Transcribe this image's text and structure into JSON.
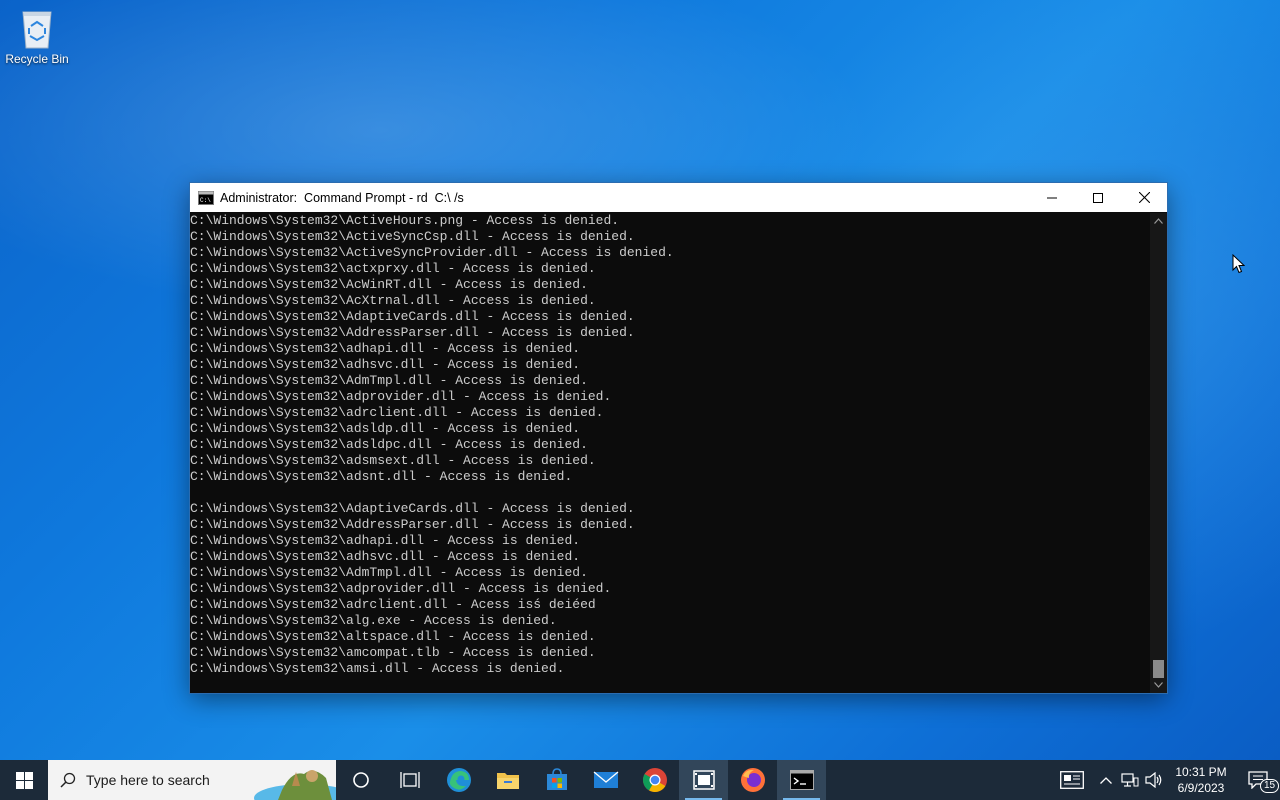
{
  "desktop": {
    "icons": [
      {
        "label": "Recycle Bin",
        "icon": "recycle-bin-icon"
      }
    ]
  },
  "console": {
    "title": "Administrator:  Command Prompt - rd  C:\\ /s",
    "lines": [
      "C:\\Windows\\System32\\ActiveHours.png - Access is denied.",
      "C:\\Windows\\System32\\ActiveSyncCsp.dll - Access is denied.",
      "C:\\Windows\\System32\\ActiveSyncProvider.dll - Access is denied.",
      "C:\\Windows\\System32\\actxprxy.dll - Access is denied.",
      "C:\\Windows\\System32\\AcWinRT.dll - Access is denied.",
      "C:\\Windows\\System32\\AcXtrnal.dll - Access is denied.",
      "C:\\Windows\\System32\\AdaptiveCards.dll - Access is denied.",
      "C:\\Windows\\System32\\AddressParser.dll - Access is denied.",
      "C:\\Windows\\System32\\adhapi.dll - Access is denied.",
      "C:\\Windows\\System32\\adhsvc.dll - Access is denied.",
      "C:\\Windows\\System32\\AdmTmpl.dll - Access is denied.",
      "C:\\Windows\\System32\\adprovider.dll - Access is denied.",
      "C:\\Windows\\System32\\adrclient.dll - Access is denied.",
      "C:\\Windows\\System32\\adsldp.dll - Access is denied.",
      "C:\\Windows\\System32\\adsldpc.dll - Access is denied.",
      "C:\\Windows\\System32\\adsmsext.dll - Access is denied.",
      "C:\\Windows\\System32\\adsnt.dll - Access is denied.",
      "",
      "C:\\Windows\\System32\\AdaptiveCards.dll - Access is denied.",
      "C:\\Windows\\System32\\AddressParser.dll - Access is denied.",
      "C:\\Windows\\System32\\adhapi.dll - Access is denied.",
      "C:\\Windows\\System32\\adhsvc.dll - Access is denied.",
      "C:\\Windows\\System32\\AdmTmpl.dll - Access is denied.",
      "C:\\Windows\\System32\\adprovider.dll - Access is denied.",
      "C:\\Windows\\System32\\adrclient.dll - Acess isś deiéed",
      "C:\\Windows\\System32\\alg.exe - Access is denied.",
      "C:\\Windows\\System32\\altspace.dll - Access is denied.",
      "C:\\Windows\\System32\\amcompat.tlb - Access is denied.",
      "C:\\Windows\\System32\\amsi.dll - Access is denied."
    ]
  },
  "taskbar": {
    "search_placeholder": "Type here to search",
    "apps": [
      {
        "name": "cortana-icon",
        "active": false
      },
      {
        "name": "task-view-icon",
        "active": false
      },
      {
        "name": "edge-icon",
        "active": false
      },
      {
        "name": "file-explorer-icon",
        "active": false
      },
      {
        "name": "store-icon",
        "active": false
      },
      {
        "name": "mail-icon",
        "active": false
      },
      {
        "name": "chrome-icon",
        "active": false
      },
      {
        "name": "video-editor-icon",
        "active": true
      },
      {
        "name": "firefox-icon",
        "active": false
      },
      {
        "name": "command-prompt-icon",
        "active": true
      }
    ],
    "clock": {
      "time": "10:31 PM",
      "date": "6/9/2023"
    },
    "notifications_count": "15"
  },
  "colors": {
    "console_bg": "#0c0c0c",
    "console_fg": "#cccccc",
    "taskbar_bg": "#1c2a39",
    "accent": "#76b9ed"
  }
}
